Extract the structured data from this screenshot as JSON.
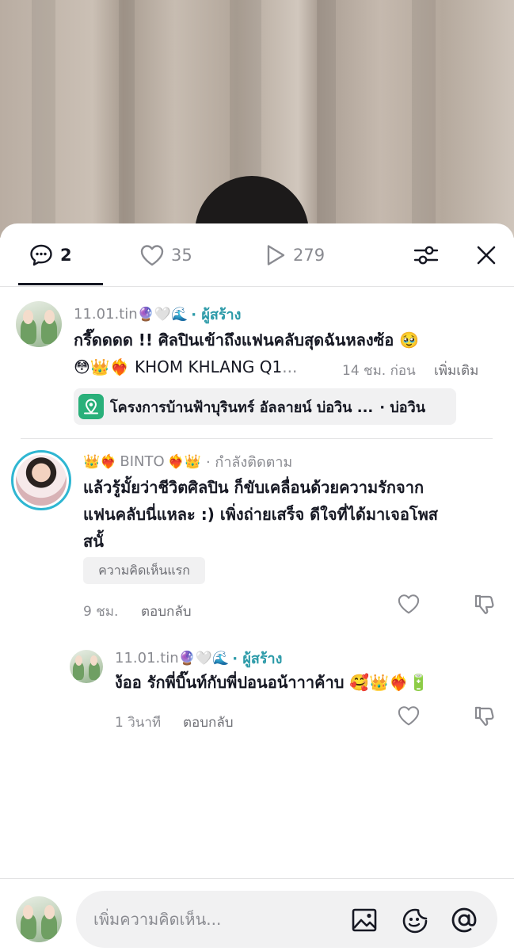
{
  "tabs": {
    "comments": {
      "count": "2"
    },
    "likes": {
      "count": "35"
    },
    "plays": {
      "count": "279"
    }
  },
  "post": {
    "author": "11.01.tin",
    "author_emoji": "🔮🤍🌊",
    "creator_label": "· ผู้สร้าง",
    "text_line1": "กรี๊ดดดด !! ศิลปินเข้าถึงแฟนคลับสุดฉันหลงซ้อ 🥹",
    "text_line2": "😳👑❤️‍🔥 KHOM KHLANG Q1",
    "ellipsis": "...",
    "time": "14 ชม. ก่อน",
    "more": "เพิ่มเติม",
    "location_name": "โครงการบ้านฟ้าบุรินทร์ อัลลายน์ บ่อวิน ...",
    "location_suffix": "· บ่อวิน"
  },
  "comment1": {
    "emoji_pre": "👑❤️‍🔥",
    "author": "BINTO",
    "emoji_post": "❤️‍🔥👑",
    "following_label": "· กำลังติดตาม",
    "line1": "แล้วรู้มั้ยว่าชีวิตศิลปิน ก็ขับเคลื่อนด้วยความรักจาก",
    "line2": "แฟนคลับนี่แหละ :) เพิ่งถ่ายเสร็จ ดีใจที่ได้มาเจอโพส",
    "line3": "สนั้",
    "chip": "ความคิดเห็นแรก",
    "time": "9 ชม.",
    "reply": "ตอบกลับ"
  },
  "reply1": {
    "author": "11.01.tin",
    "author_emoji": "🔮🤍🌊",
    "creator_label": "· ผู้สร้าง",
    "text": "ง้ออ รักพี่บิ๊นท์กับพี่ปอนอน้าาาค้าบ 🥰👑❤️‍🔥🔋",
    "time": "1 วินาที",
    "reply": "ตอบกลับ"
  },
  "composer": {
    "placeholder": "เพิ่มความคิดเห็น..."
  },
  "icons": {
    "comment": "comment-bubble-icon",
    "like": "heart-icon",
    "play": "play-icon",
    "filter": "sliders-icon",
    "close": "close-icon",
    "location": "location-pin-icon",
    "dislike": "thumbs-down-icon",
    "image": "image-icon",
    "sticker": "sticker-icon",
    "mention": "at-icon"
  },
  "colors": {
    "creator": "#2b9aa8",
    "location_pin": "#29b07a",
    "avatar_ring": "#2fb6d2"
  }
}
